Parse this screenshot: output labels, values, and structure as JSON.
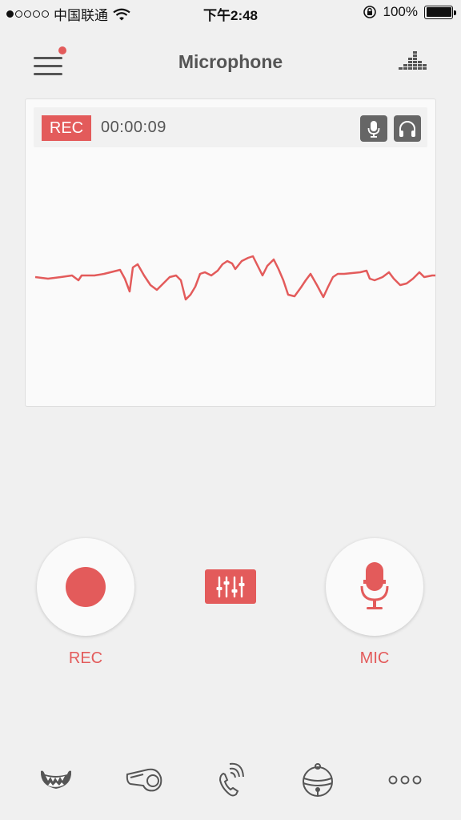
{
  "status_bar": {
    "carrier": "中国联通",
    "time": "下午2:48",
    "battery": "100%"
  },
  "header": {
    "title": "Microphone",
    "menu_icon": "hamburger-menu-icon",
    "equalizer_icon": "equalizer-bars-icon"
  },
  "panel": {
    "rec_badge": "REC",
    "timer": "00:00:09",
    "mic_toggle_icon": "microphone-icon",
    "headphones_icon": "headphones-icon"
  },
  "controls": {
    "rec_label": "REC",
    "mic_label": "MIC",
    "mixer_icon": "sliders-icon"
  },
  "tabs": [
    {
      "icon": "monster-mouth-icon"
    },
    {
      "icon": "whistle-icon"
    },
    {
      "icon": "phone-call-icon"
    },
    {
      "icon": "bell-icon"
    },
    {
      "icon": "more-dots-icon"
    }
  ],
  "colors": {
    "accent": "#e35b5b",
    "background": "#f0f0f0",
    "panel": "#fafafa"
  }
}
